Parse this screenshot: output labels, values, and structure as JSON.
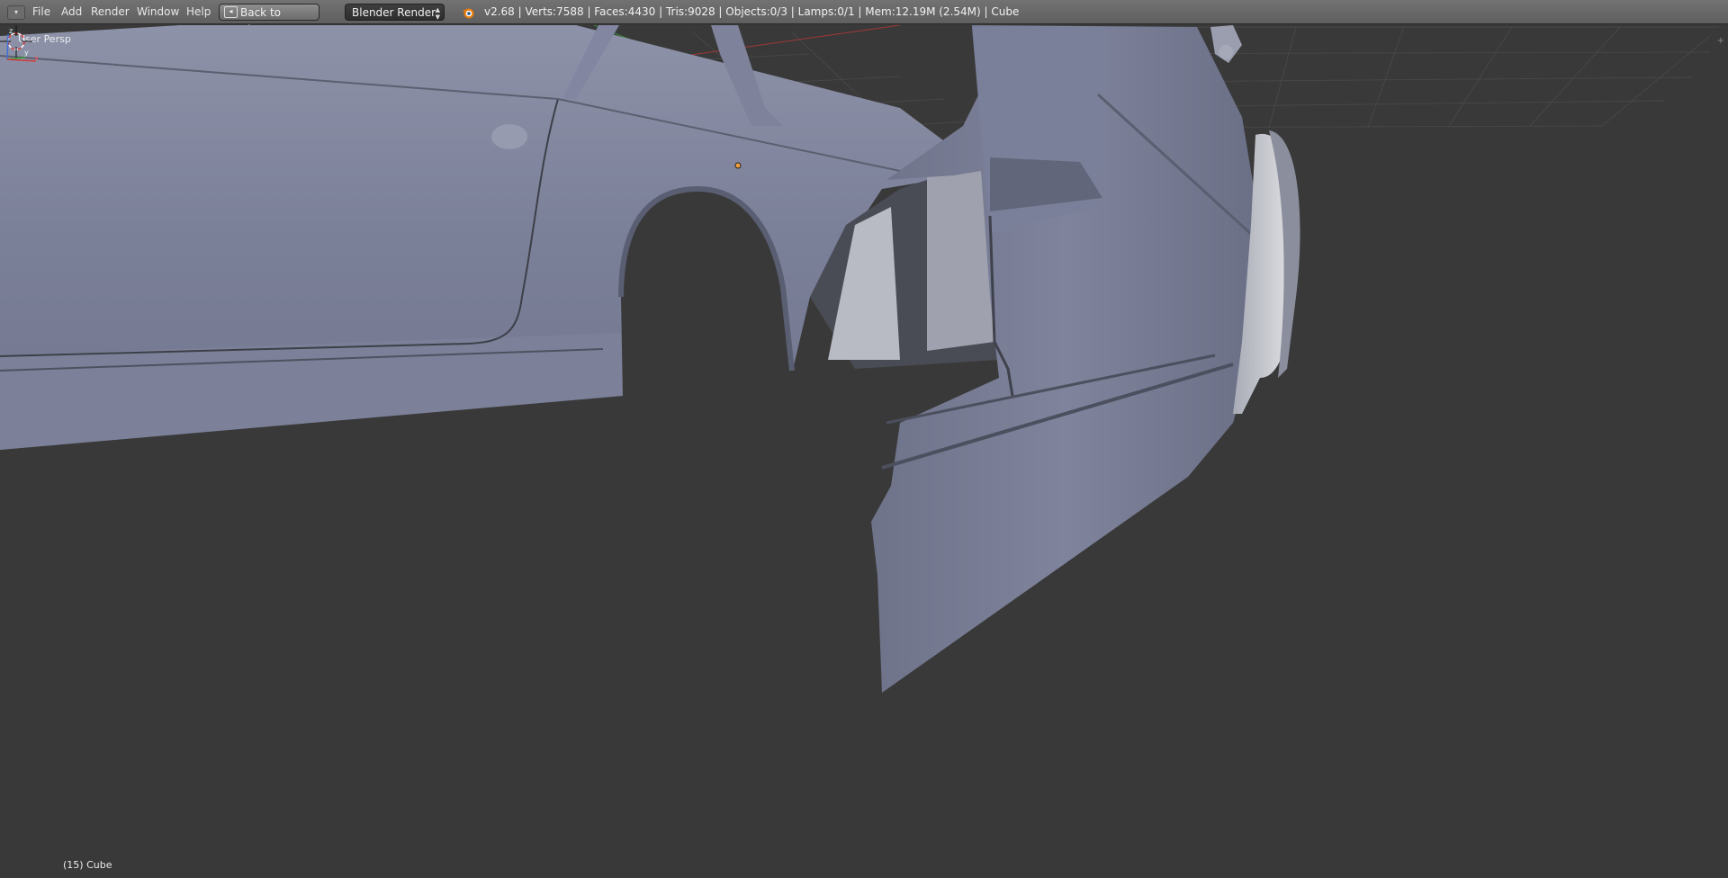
{
  "header": {
    "editor_icon": "editor-type-icon",
    "menus": [
      "File",
      "Add",
      "Render",
      "Window",
      "Help"
    ],
    "back_button": "Back to Previous",
    "render_engine": "Blender Render",
    "stats": "v2.68 | Verts:7588 | Faces:4430 | Tris:9028 | Objects:0/3 | Lamps:0/1 | Mem:12.19M (2.54M) | Cube"
  },
  "viewport": {
    "view_label": "User Persp",
    "object_label": "(15) Cube",
    "axis": {
      "z": "z",
      "y": "y",
      "x": "x"
    }
  },
  "colors": {
    "background": "#393939",
    "mesh": "#7a7f96",
    "grid": "#474747",
    "x_axis": "#a03838",
    "y_axis": "#3a8a3a"
  }
}
